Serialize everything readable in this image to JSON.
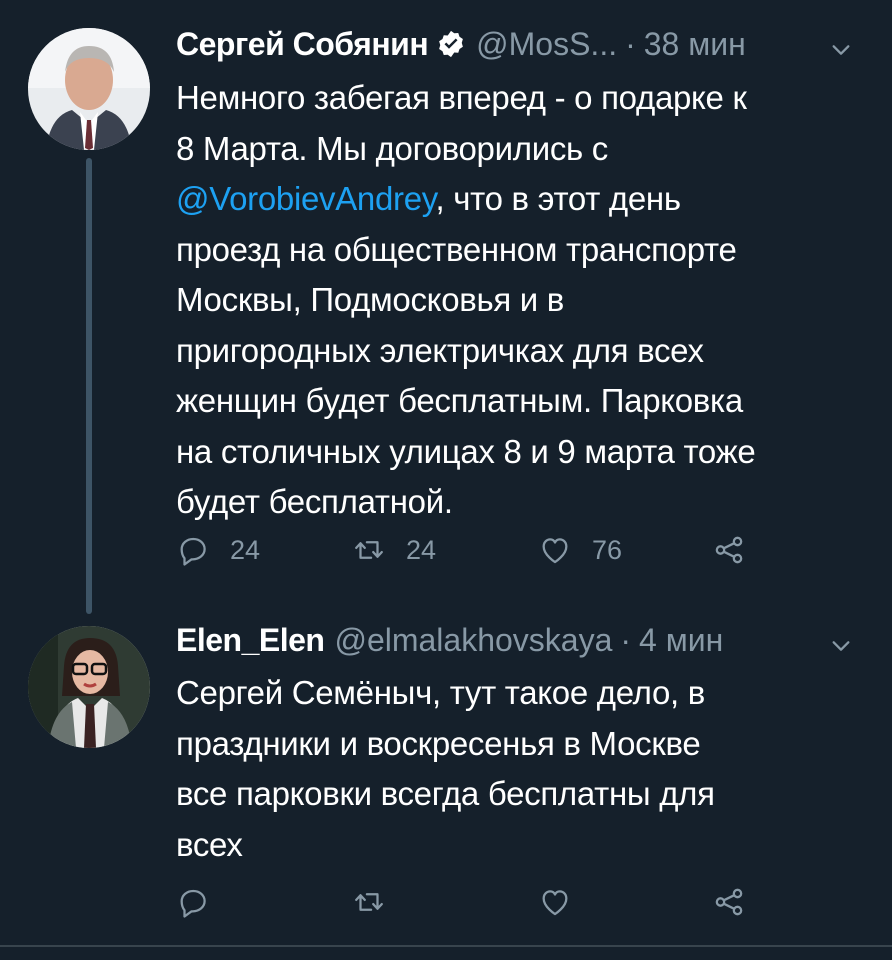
{
  "tweets": [
    {
      "author_name": "Сергей Собянин",
      "verified": true,
      "handle": "@MosS...",
      "separator": "·",
      "time": "38 мин",
      "text_lines": [
        "Немного забегая вперед - о подарке к",
        "8 Марта. Мы договорились с",
        "@VorobievAndrey",
        ", что в этот день",
        "проезд на общественном транспорте",
        "Москвы, Подмосковья и в",
        "пригородных электричках для всех",
        "женщин будет бесплатным. Парковка",
        "на столичных улицах 8 и 9 марта тоже",
        "будет бесплатной."
      ],
      "replies": "24",
      "retweets": "24",
      "likes": "76",
      "avatar_icon": "avatar-sobyanin"
    },
    {
      "author_name": "Elen_Elen",
      "verified": false,
      "handle": "@elmalakhovskaya",
      "separator": "·",
      "time": "4 мин",
      "text_lines": [
        "Сергей Семёныч, тут такое дело, в",
        "праздники и воскресенья в Москве",
        "все парковки всегда бесплатны для",
        "всех"
      ],
      "avatar_icon": "avatar-elen"
    }
  ],
  "icons": {
    "reply": "reply-icon",
    "retweet": "retweet-icon",
    "like": "like-icon",
    "share": "share-icon",
    "caret": "chevron-down-icon",
    "verified": "verified-badge-icon"
  },
  "colors": {
    "background": "#15202b",
    "text": "#ffffff",
    "secondary": "#8899a6",
    "accent": "#1da1f2",
    "thread_line": "#3d5466"
  }
}
